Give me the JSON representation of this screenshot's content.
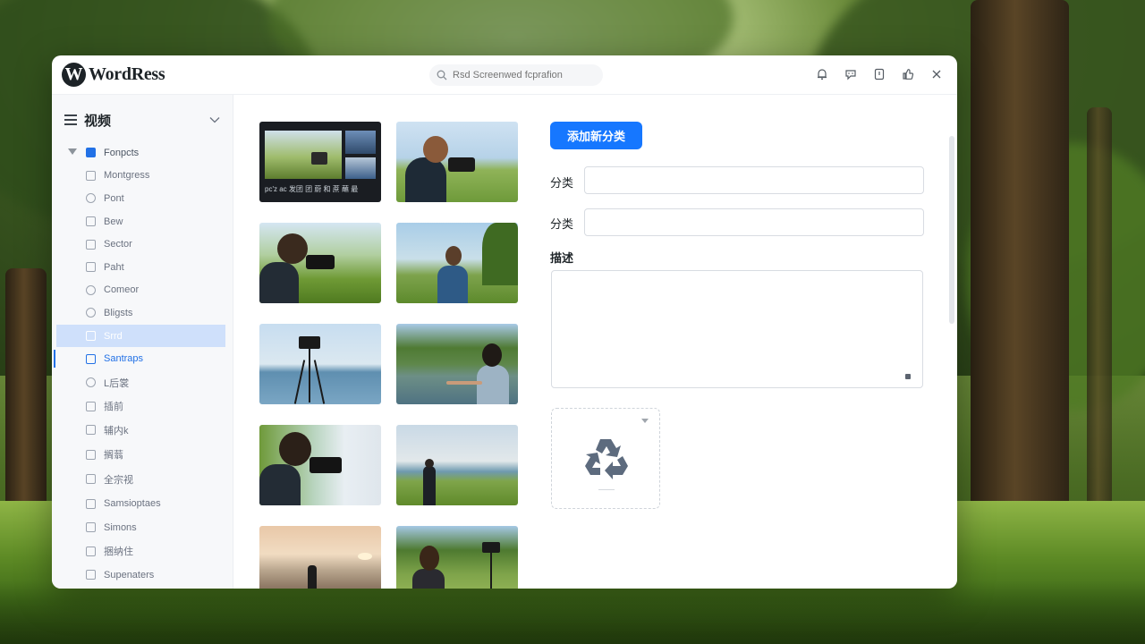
{
  "app": {
    "logo_mark": "W",
    "logo_text": "WordRess"
  },
  "search": {
    "placeholder": "Rsd Screenwed fcprafion"
  },
  "sidebar": {
    "title": "视频",
    "items": [
      {
        "label": "Fonpcts"
      },
      {
        "label": "Montgress"
      },
      {
        "label": "Pont"
      },
      {
        "label": "Bew"
      },
      {
        "label": "Sector"
      },
      {
        "label": "Paht"
      },
      {
        "label": "Comeor"
      },
      {
        "label": "Bligsts"
      },
      {
        "label": "Srrd"
      },
      {
        "label": "Santraps"
      },
      {
        "label": "L后裳"
      },
      {
        "label": "插前"
      },
      {
        "label": "辅内k"
      },
      {
        "label": "搁蓊"
      },
      {
        "label": "全宗视"
      },
      {
        "label": "Samsioptaes"
      },
      {
        "label": "Simons"
      },
      {
        "label": "捆纳住"
      },
      {
        "label": "Supenaters"
      }
    ]
  },
  "media": {
    "thumbs": [
      {
        "caption": "pc'z ac 发团 团 蔚 和 蔗 蘸 最"
      }
    ]
  },
  "form": {
    "add_button": "添加新分类",
    "field1_label": "分类",
    "field1_value": "",
    "field2_label": "分类",
    "field2_value": "",
    "desc_label": "描述",
    "desc_value": ""
  },
  "colors": {
    "accent": "#1677ff",
    "sidebar_selected": "#cfe0fb",
    "active_text": "#2271e6"
  }
}
